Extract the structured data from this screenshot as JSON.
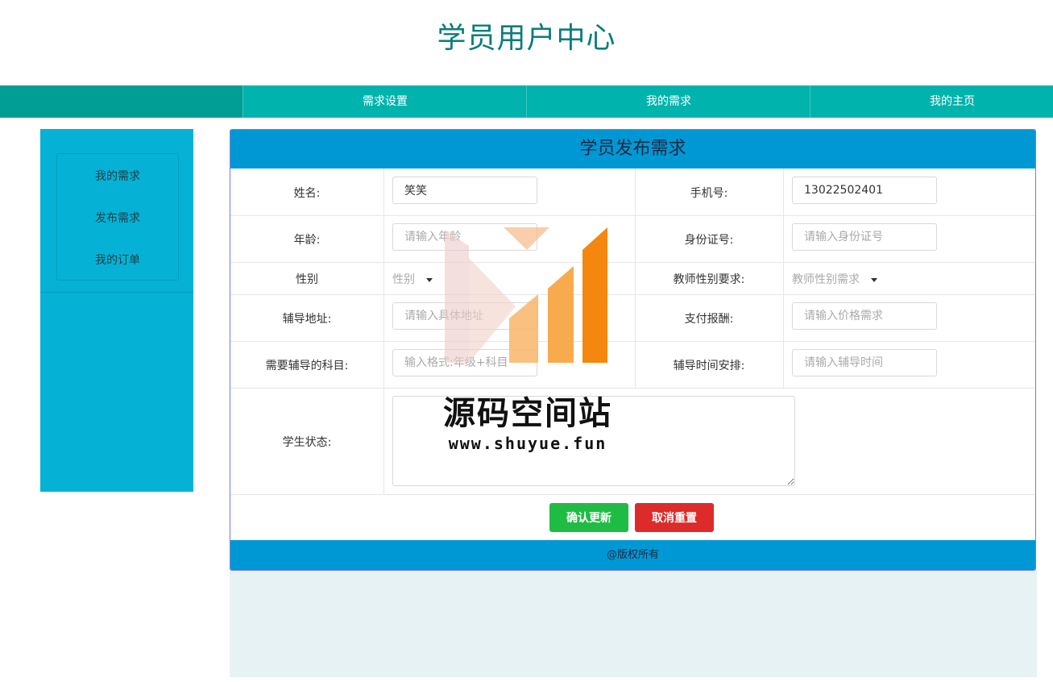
{
  "header": {
    "title": "学员用户中心"
  },
  "nav": {
    "items": [
      "需求设置",
      "我的需求",
      "我的主页"
    ]
  },
  "sidebar": {
    "items": [
      "我的需求",
      "发布需求",
      "我的订单"
    ]
  },
  "form": {
    "title": "学员发布需求",
    "name": {
      "label": "姓名:",
      "value": "笑笑"
    },
    "phone": {
      "label": "手机号:",
      "value": "13022502401"
    },
    "age": {
      "label": "年龄:",
      "placeholder": "请输入年龄"
    },
    "id_card": {
      "label": "身份证号:",
      "placeholder": "请输入身份证号"
    },
    "gender": {
      "label": "性别",
      "selected": "性别"
    },
    "teacher_gender": {
      "label": "教师性别要求:",
      "selected": "教师性别需求"
    },
    "address": {
      "label": "辅导地址:",
      "placeholder": "请输入具体地址"
    },
    "payment": {
      "label": "支付报酬:",
      "placeholder": "请输入价格需求"
    },
    "subject": {
      "label": "需要辅导的科目:",
      "placeholder": "输入格式:年级+科目"
    },
    "schedule": {
      "label": "辅导时间安排:",
      "placeholder": "请输入辅导时间"
    },
    "status": {
      "label": "学生状态:",
      "value": ""
    },
    "confirm_label": "确认更新",
    "cancel_label": "取消重置",
    "footer": "@版权所有"
  },
  "watermark": {
    "name": "源码空间站",
    "url": "www.shuyue.fun"
  },
  "colors": {
    "title": "#0a7c7c",
    "nav": "#00b3ad",
    "sidebar": "#05b2d6",
    "panel_header": "#0098d4",
    "confirm": "#1fbc44",
    "cancel": "#dd2a2a"
  }
}
